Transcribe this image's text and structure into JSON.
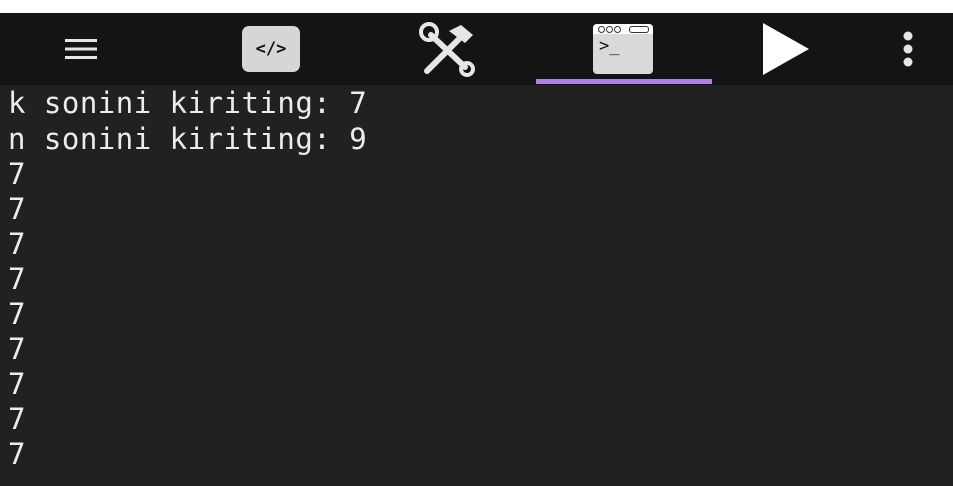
{
  "toolbar": {
    "items": [
      {
        "icon": "hamburger-menu-icon"
      },
      {
        "icon": "code-editor-icon"
      },
      {
        "icon": "tools-icon"
      },
      {
        "icon": "terminal-icon",
        "selected": true
      },
      {
        "icon": "run-play-icon"
      },
      {
        "icon": "more-vertical-icon"
      }
    ],
    "code_icon_text": "</>",
    "terminal_prompt": ">_",
    "accent_color": "#b07fe0"
  },
  "console": {
    "lines": [
      "k sonini kiriting: 7",
      "n sonini kiriting: 9",
      "7",
      "7",
      "7",
      "7",
      "7",
      "7",
      "7",
      "7",
      "7"
    ]
  }
}
